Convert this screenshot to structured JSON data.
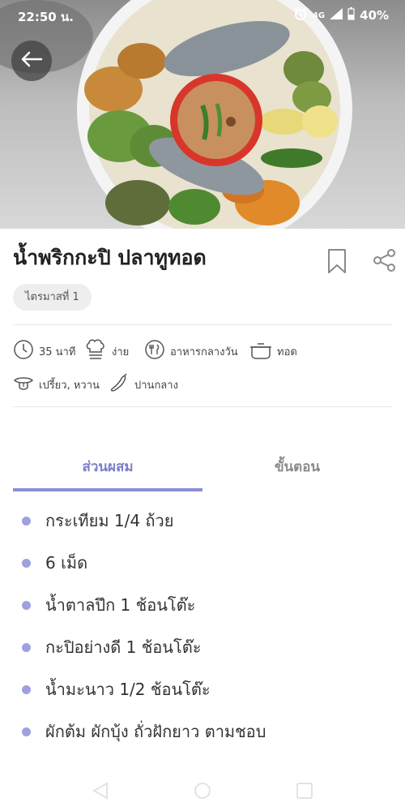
{
  "status_bar": {
    "time": "22:50 น.",
    "network": "4G",
    "battery": "40%"
  },
  "recipe": {
    "title": "น้ำพริกกะปิ ปลาทูทอด",
    "tag": "ไตรมาสที่ 1",
    "meta": {
      "time": "35 นาที",
      "difficulty": "ง่าย",
      "meal": "อาหารกลางวัน",
      "method": "ทอด",
      "taste": "เปรี้ยว, หวาน",
      "spiciness": "ปานกลาง"
    }
  },
  "tabs": {
    "ingredients": "ส่วนผสม",
    "steps": "ขั้นตอน"
  },
  "ingredients": [
    "กระเทียม 1/4 ถ้วย",
    "6 เม็ด",
    "น้ำตาลปึก 1 ช้อนโต๊ะ",
    "กะปิอย่างดี 1 ช้อนโต๊ะ",
    "น้ำมะนาว 1/2 ช้อนโต๊ะ",
    "ผักต้ม ผักบุ้ง ถั่วฝักยาว ตามชอบ"
  ],
  "colors": {
    "accent": "#8c8fd6",
    "tab_active_text": "#7b7fc9",
    "bullet": "#9fa0de"
  },
  "icons": [
    "back-arrow-icon",
    "bookmark-icon",
    "share-icon",
    "clock-icon",
    "chef-hat-icon",
    "utensils-icon",
    "pot-icon",
    "tongue-icon",
    "chili-icon"
  ]
}
